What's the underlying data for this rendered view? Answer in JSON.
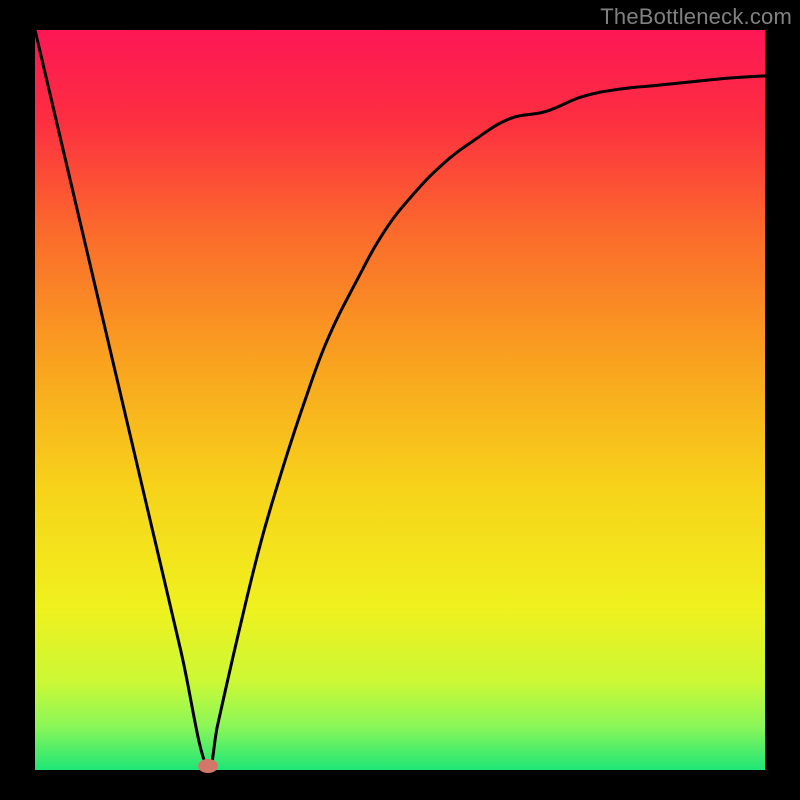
{
  "attribution": "TheBottleneck.com",
  "chart_data": {
    "type": "line",
    "title": "",
    "xlabel": "",
    "ylabel": "",
    "x": [
      0.0,
      0.05,
      0.1,
      0.15,
      0.2,
      0.237,
      0.25,
      0.28,
      0.31,
      0.34,
      0.37,
      0.4,
      0.44,
      0.48,
      0.52,
      0.56,
      0.6,
      0.65,
      0.7,
      0.75,
      0.8,
      0.85,
      0.9,
      0.95,
      1.0
    ],
    "values": [
      1.0,
      0.79,
      0.58,
      0.37,
      0.16,
      0.0,
      0.06,
      0.19,
      0.31,
      0.41,
      0.5,
      0.58,
      0.66,
      0.73,
      0.78,
      0.82,
      0.85,
      0.88,
      0.89,
      0.91,
      0.92,
      0.925,
      0.93,
      0.935,
      0.938
    ],
    "xlim": [
      0,
      1
    ],
    "ylim": [
      0,
      1
    ],
    "minimum_marker": {
      "x": 0.237,
      "y": 0.0
    },
    "background_gradient": {
      "stops": [
        {
          "offset": 0.0,
          "color": "#fd1755"
        },
        {
          "offset": 0.12,
          "color": "#fd2e41"
        },
        {
          "offset": 0.28,
          "color": "#fb6d2b"
        },
        {
          "offset": 0.45,
          "color": "#f9a31f"
        },
        {
          "offset": 0.62,
          "color": "#f7d31a"
        },
        {
          "offset": 0.78,
          "color": "#f0f11e"
        },
        {
          "offset": 0.88,
          "color": "#ccf835"
        },
        {
          "offset": 0.94,
          "color": "#8cf758"
        },
        {
          "offset": 1.0,
          "color": "#1ee677"
        }
      ]
    }
  },
  "plot": {
    "outer_width": 800,
    "outer_height": 800,
    "inner_x": 35,
    "inner_y": 30,
    "inner_width": 730,
    "inner_height": 740,
    "marker_color": "#d4776b",
    "curve_color": "#000000"
  }
}
